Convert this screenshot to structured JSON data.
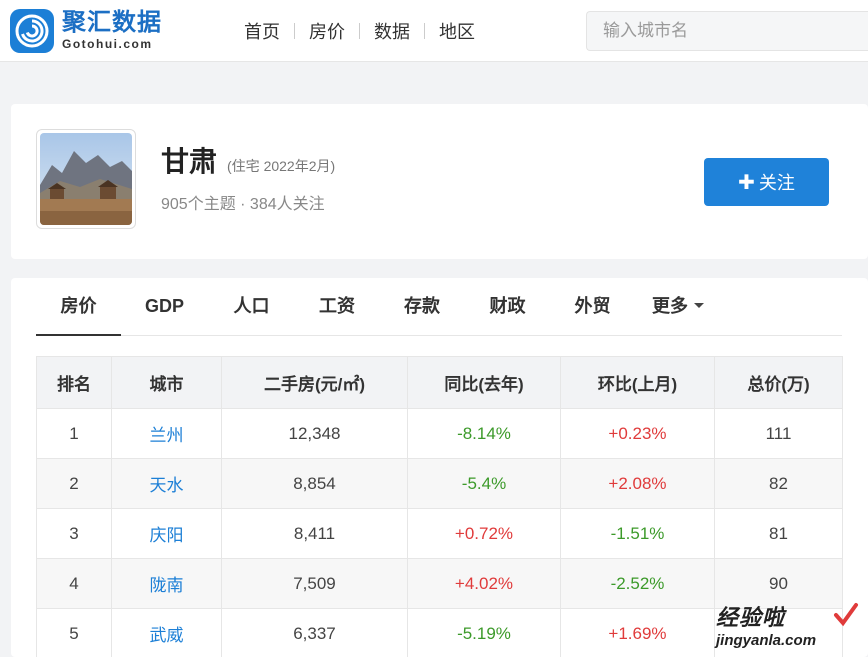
{
  "header": {
    "logo_cn": "聚汇数据",
    "logo_en": "Gotohui.com",
    "nav": [
      "首页",
      "房价",
      "数据",
      "地区"
    ],
    "search_placeholder": "输入城市名"
  },
  "region": {
    "name": "甘肃",
    "subtitle": "(住宅 2022年2月)",
    "stats": "905个主题 · 384人关注",
    "follow_label": "关注",
    "follow_icon": "plus-icon"
  },
  "tabs": [
    {
      "label": "房价",
      "active": true
    },
    {
      "label": "GDP"
    },
    {
      "label": "人口"
    },
    {
      "label": "工资"
    },
    {
      "label": "存款"
    },
    {
      "label": "财政"
    },
    {
      "label": "外贸"
    },
    {
      "label": "更多",
      "dropdown": true
    }
  ],
  "table": {
    "headers": [
      "排名",
      "城市",
      "二手房(元/㎡)",
      "同比(去年)",
      "环比(上月)",
      "总价(万)"
    ],
    "rows": [
      [
        "1",
        "兰州",
        "12,348",
        "-8.14%",
        "+0.23%",
        "111"
      ],
      [
        "2",
        "天水",
        "8,854",
        "-5.4%",
        "+2.08%",
        "82"
      ],
      [
        "3",
        "庆阳",
        "8,411",
        "+0.72%",
        "-1.51%",
        "81"
      ],
      [
        "4",
        "陇南",
        "7,509",
        "+4.02%",
        "-2.52%",
        "90"
      ],
      [
        "5",
        "武威",
        "6,337",
        "-5.19%",
        "+1.69%",
        ""
      ]
    ]
  },
  "colors": {
    "accent": "#1f82d9",
    "up": "#e03b3b",
    "down": "#3c9a2a"
  },
  "watermark": {
    "top": "经验啦",
    "bottom": "jingyanla.com"
  }
}
